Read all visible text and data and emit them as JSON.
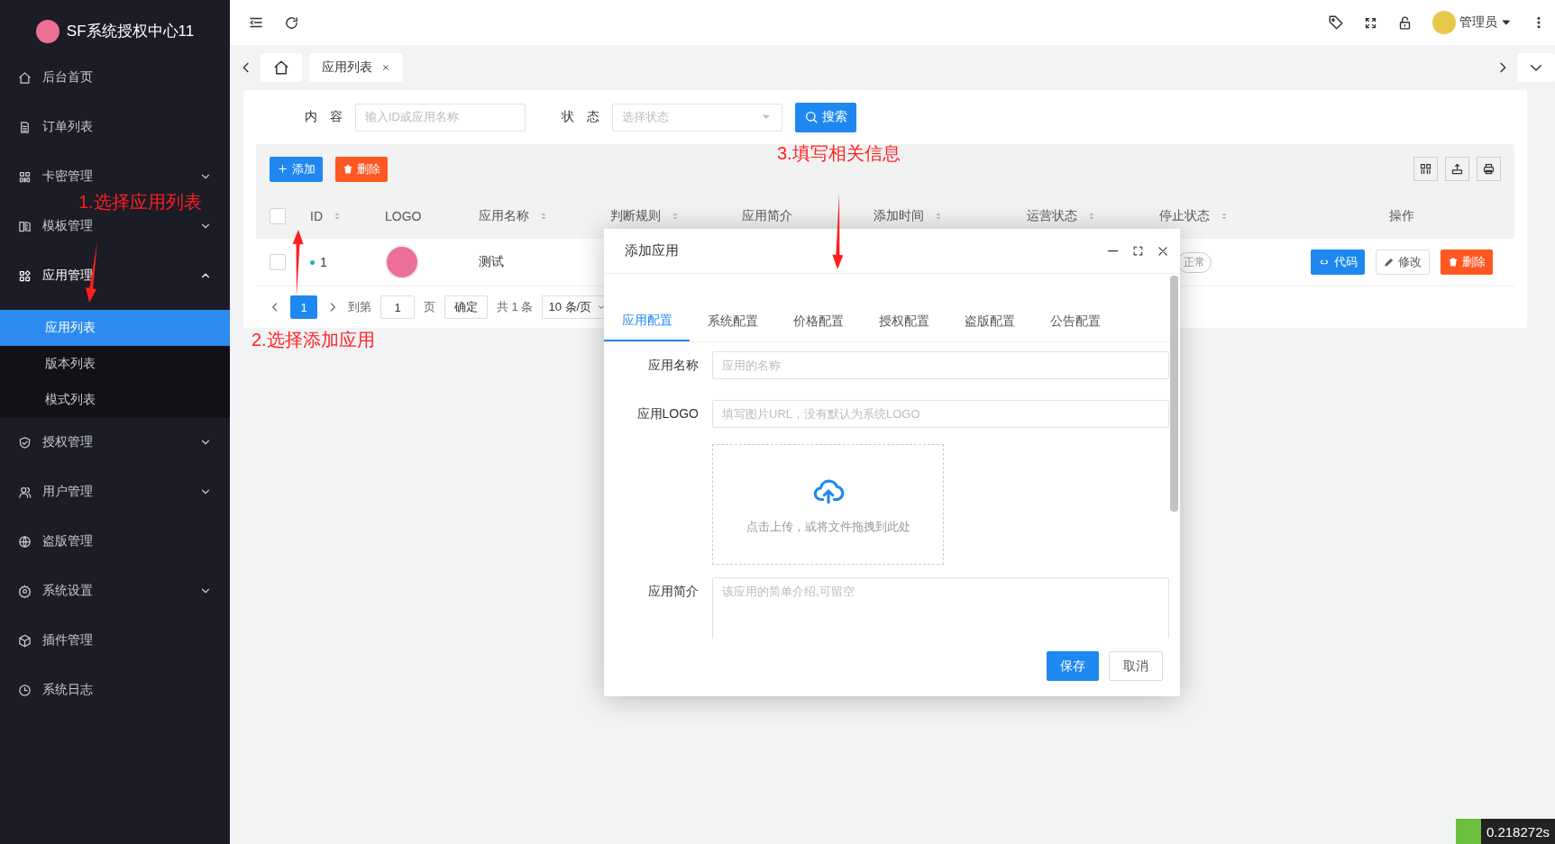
{
  "sidebar": {
    "logo_text": "SF系统授权中心11",
    "items": [
      {
        "label": "后台首页",
        "kind": "link"
      },
      {
        "label": "订单列表",
        "kind": "link"
      },
      {
        "label": "卡密管理",
        "kind": "group",
        "expanded": false
      },
      {
        "label": "模板管理",
        "kind": "group",
        "expanded": false
      },
      {
        "label": "应用管理",
        "kind": "group",
        "expanded": true,
        "children": [
          {
            "label": "应用列表",
            "selected": true
          },
          {
            "label": "版本列表",
            "selected": false
          },
          {
            "label": "模式列表",
            "selected": false
          }
        ]
      },
      {
        "label": "授权管理",
        "kind": "group",
        "expanded": false
      },
      {
        "label": "用户管理",
        "kind": "group",
        "expanded": false
      },
      {
        "label": "盗版管理",
        "kind": "link"
      },
      {
        "label": "系统设置",
        "kind": "group",
        "expanded": false
      },
      {
        "label": "插件管理",
        "kind": "link"
      },
      {
        "label": "系统日志",
        "kind": "link"
      }
    ]
  },
  "topbar": {
    "user": "管理员"
  },
  "page_tabs": [
    {
      "kind": "home"
    },
    {
      "kind": "page",
      "label": "应用列表"
    }
  ],
  "search": {
    "fields": [
      {
        "kind": "input",
        "label": "内 容",
        "placeholder": "输入ID或应用名称"
      },
      {
        "kind": "select",
        "label": "状 态",
        "placeholder": "选择状态"
      }
    ],
    "button": "搜索"
  },
  "toolbar": {
    "buttons": [
      {
        "label": "添加",
        "kind": "primary"
      },
      {
        "label": "删除",
        "kind": "danger"
      }
    ]
  },
  "table": {
    "select_all_checked": false,
    "columns": [
      {
        "label": "ID",
        "sortable": true
      },
      {
        "label": "LOGO",
        "sortable": false
      },
      {
        "label": "应用名称",
        "sortable": true
      },
      {
        "label": "判断规则",
        "sortable": true
      },
      {
        "label": "应用简介",
        "sortable": false
      },
      {
        "label": "添加时间",
        "sortable": true
      },
      {
        "label": "运营状态",
        "sortable": true
      },
      {
        "label": "停止状态",
        "sortable": true
      },
      {
        "label": "操作",
        "sortable": false
      }
    ],
    "rows": [
      {
        "checked": false,
        "id": "1",
        "name": "测试",
        "stop_status": "正常",
        "actions": [
          {
            "label": "代码",
            "kind": "primary"
          },
          {
            "label": "修改",
            "kind": "default"
          },
          {
            "label": "删除",
            "kind": "danger"
          }
        ]
      }
    ]
  },
  "pagination": {
    "current": "1",
    "goto_label": "到第",
    "page_input": "1",
    "page_label": "页",
    "confirm": "确定",
    "total": "共 1 条",
    "page_size": "10 条/页"
  },
  "dialog": {
    "title": "添加应用",
    "tabs": [
      {
        "label": "应用配置",
        "selected": true
      },
      {
        "label": "系统配置",
        "selected": false
      },
      {
        "label": "价格配置",
        "selected": false
      },
      {
        "label": "授权配置",
        "selected": false
      },
      {
        "label": "盗版配置",
        "selected": false
      },
      {
        "label": "公告配置",
        "selected": false
      }
    ],
    "fields": [
      {
        "kind": "input",
        "label": "应用名称",
        "placeholder": "应用的名称"
      },
      {
        "kind": "input",
        "label": "应用LOGO",
        "placeholder": "填写图片URL，没有默认为系统LOGO"
      },
      {
        "kind": "upload",
        "hint": "点击上传，或将文件拖拽到此处"
      },
      {
        "kind": "textarea",
        "label": "应用简介",
        "placeholder": "该应用的简单介绍,可留空"
      }
    ],
    "buttons": [
      {
        "label": "保存",
        "kind": "primary"
      },
      {
        "label": "取消",
        "kind": "default"
      }
    ]
  },
  "annotations": [
    {
      "text": "1.选择应用列表"
    },
    {
      "text": "2.选择添加应用"
    },
    {
      "text": "3.填写相关信息"
    }
  ],
  "timer": {
    "text": "0.218272s"
  }
}
